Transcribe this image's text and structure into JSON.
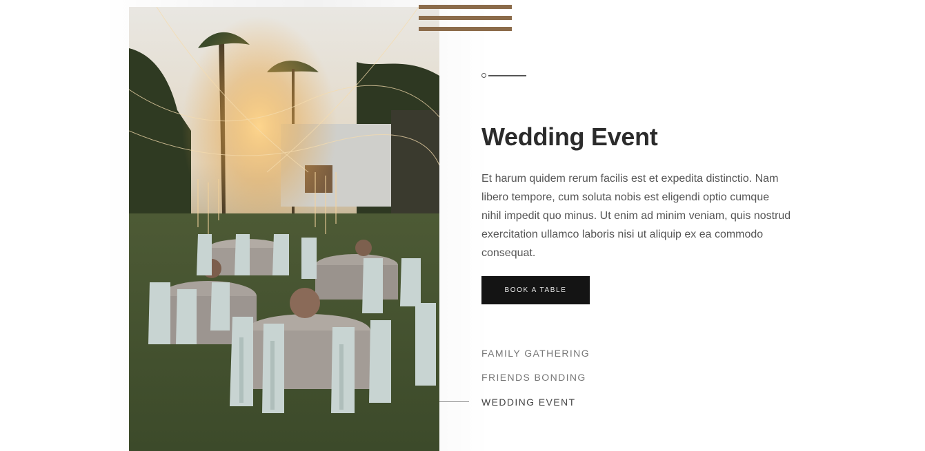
{
  "colors": {
    "accent": "#8b6b4a",
    "button_bg": "#141414",
    "heading": "#2b2b2b",
    "body_text": "#555555"
  },
  "image": {
    "alt": "Outdoor wedding reception with round tables, draped chairs and string lights at sunset"
  },
  "decor": {
    "stripes_icon": "stripes-decoration",
    "indicator_icon": "circle-line-indicator"
  },
  "section": {
    "title": "Wedding Event",
    "description": "Et harum quidem rerum facilis est et expedita distinctio. Nam libero tempore, cum soluta nobis est eligendi optio cumque nihil impedit quo minus. Ut enim ad minim veniam, quis nostrud exercitation ullamco laboris nisi ut aliquip ex ea commodo consequat.",
    "button_label": "BOOK A TABLE"
  },
  "nav": {
    "items": [
      {
        "label": "FAMILY GATHERING",
        "active": false
      },
      {
        "label": "FRIENDS BONDING",
        "active": false
      },
      {
        "label": "WEDDING EVENT",
        "active": true
      }
    ]
  }
}
